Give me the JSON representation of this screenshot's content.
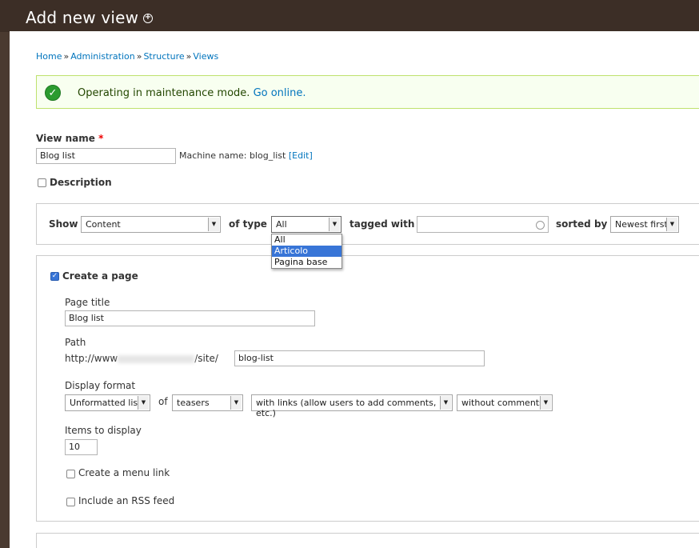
{
  "header": {
    "title": "Add new view",
    "shortcut_icon": "plus-circle-icon"
  },
  "breadcrumb": {
    "items": [
      "Home",
      "Administration",
      "Structure",
      "Views"
    ],
    "separator": "»"
  },
  "status": {
    "message": "Operating in maintenance mode.",
    "link": "Go online.",
    "icon": "check-circle-icon",
    "color": "#2b9b2f"
  },
  "view_name": {
    "label": "View name",
    "required_mark": "*",
    "value": "Blog list",
    "machine_label": "Machine name: blog_list",
    "edit_link": "[Edit]"
  },
  "description": {
    "label": "Description",
    "checked": false
  },
  "wizard": {
    "show_label": "Show",
    "show_value": "Content",
    "of_type_label": "of type",
    "type_value": "All",
    "type_options": [
      "All",
      "Articolo",
      "Pagina base"
    ],
    "type_highlighted": "Articolo",
    "tagged_with_label": "tagged with",
    "tagged_with_value": "",
    "sorted_by_label": "sorted by",
    "sorted_by_value": "Newest first"
  },
  "page": {
    "create_label": "Create a page",
    "create_checked": true,
    "title_label": "Page title",
    "title_value": "Blog list",
    "path_label": "Path",
    "path_prefix_start": "http://www",
    "path_prefix_end": "/site/",
    "path_value": "blog-list",
    "display_format_label": "Display format",
    "format_value": "Unformatted list",
    "of_label": "of",
    "row_value": "teasers",
    "links_value": "with links (allow users to add comments, etc.)",
    "comments_value": "without comments",
    "items_label": "Items to display",
    "items_value": "10",
    "menu_link_label": "Create a menu link",
    "rss_label": "Include an RSS feed"
  }
}
